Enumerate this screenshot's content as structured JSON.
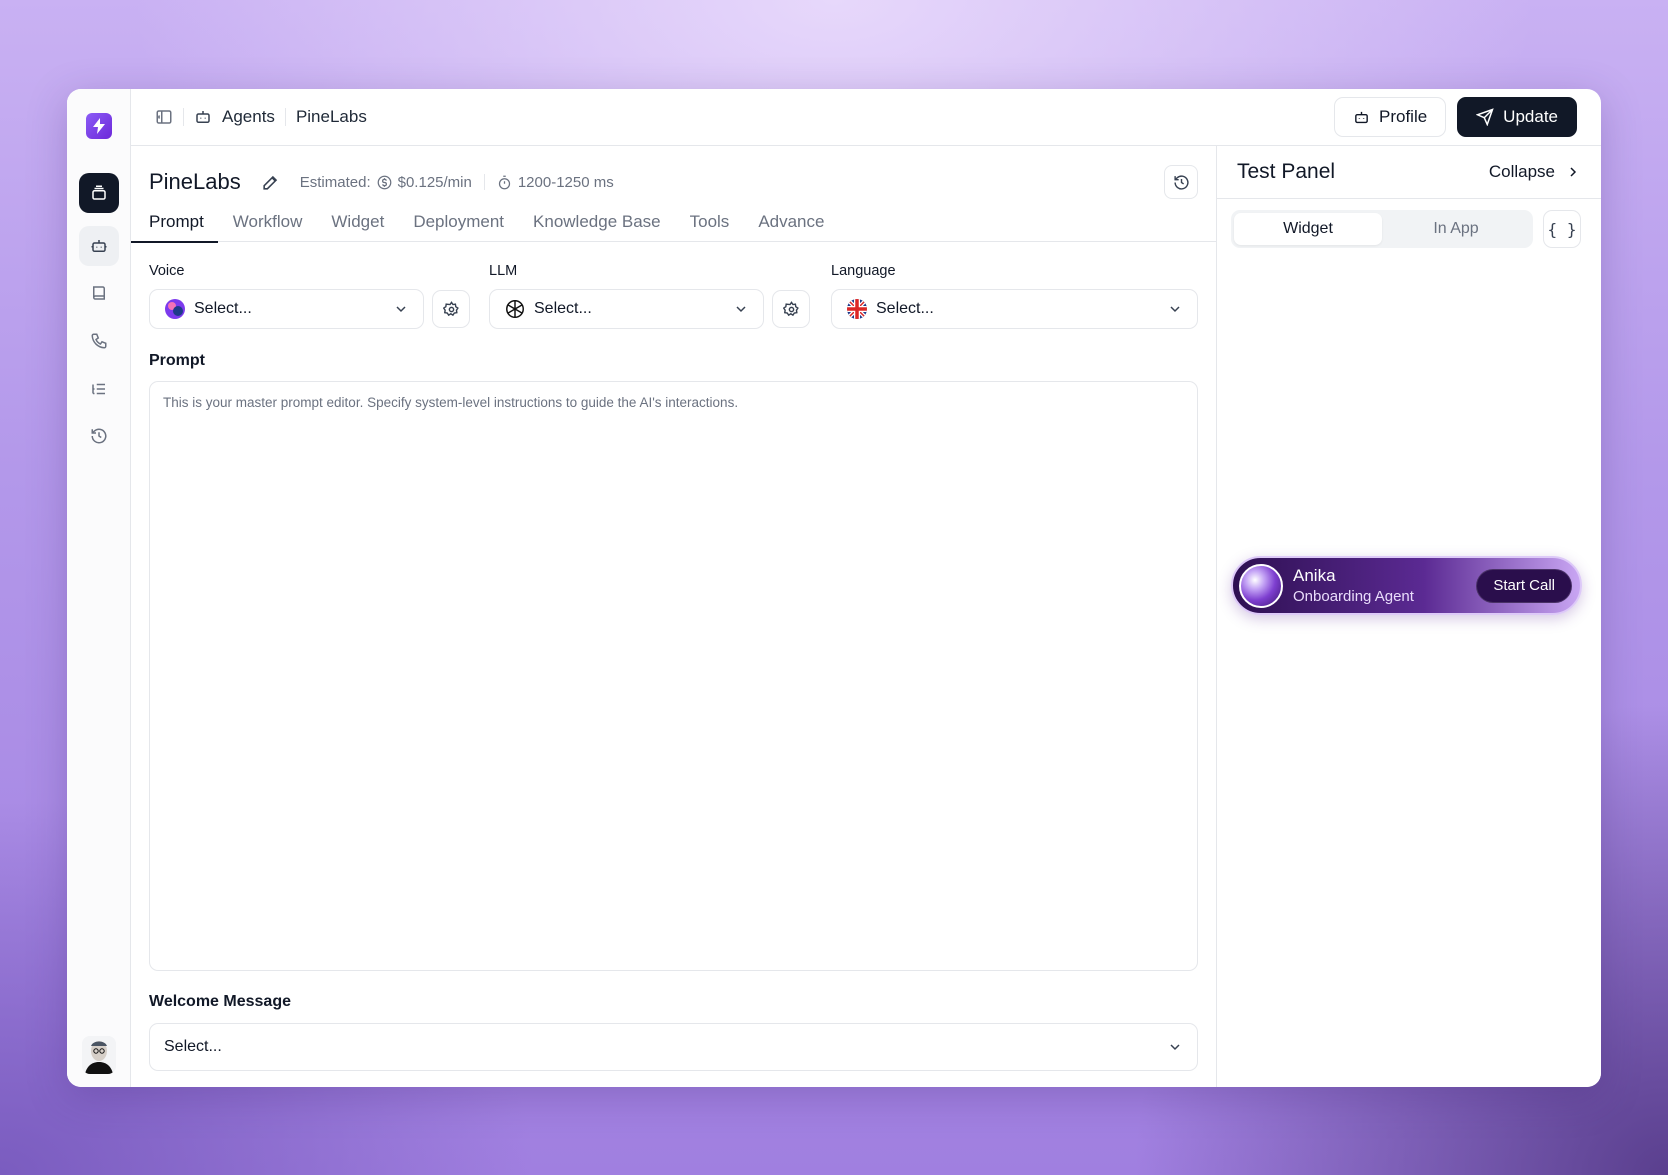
{
  "breadcrumb": {
    "section": "Agents",
    "current": "PineLabs"
  },
  "top_actions": {
    "profile_label": "Profile",
    "update_label": "Update"
  },
  "agent": {
    "name": "PineLabs",
    "estimated_label": "Estimated:",
    "cost": "$0.125/min",
    "latency": "1200-1250 ms"
  },
  "tabs": [
    {
      "label": "Prompt",
      "active": true
    },
    {
      "label": "Workflow"
    },
    {
      "label": "Widget"
    },
    {
      "label": "Deployment"
    },
    {
      "label": "Knowledge Base"
    },
    {
      "label": "Tools"
    },
    {
      "label": "Advance"
    }
  ],
  "fields": {
    "voice": {
      "label": "Voice",
      "value": "Select..."
    },
    "llm": {
      "label": "LLM",
      "value": "Select..."
    },
    "language": {
      "label": "Language",
      "value": "Select..."
    }
  },
  "prompt": {
    "label": "Prompt",
    "placeholder": "This is your master prompt editor. Specify system-level instructions to guide the AI's interactions."
  },
  "welcome_message": {
    "label": "Welcome Message",
    "value": "Select..."
  },
  "test_panel": {
    "title": "Test Panel",
    "collapse_label": "Collapse",
    "segments": [
      {
        "label": "Widget",
        "active": true
      },
      {
        "label": "In App"
      }
    ],
    "code_label": "{ }",
    "widget": {
      "name": "Anika",
      "role": "Onboarding Agent",
      "cta": "Start Call"
    }
  },
  "colors": {
    "accent": "#7c3aed",
    "dark": "#111827",
    "border": "#e5e7eb",
    "muted": "#6b7280"
  },
  "icons": [
    "logo-bolt-icon",
    "stack-icon",
    "robot-icon",
    "book-icon",
    "phone-icon",
    "list-icon",
    "history-icon",
    "sidebar-toggle-icon",
    "pencil-icon",
    "dollar-icon",
    "timer-icon",
    "gear-icon",
    "chevron-down-icon",
    "send-icon",
    "chevron-right-icon",
    "openai-icon",
    "uk-flag-icon"
  ]
}
